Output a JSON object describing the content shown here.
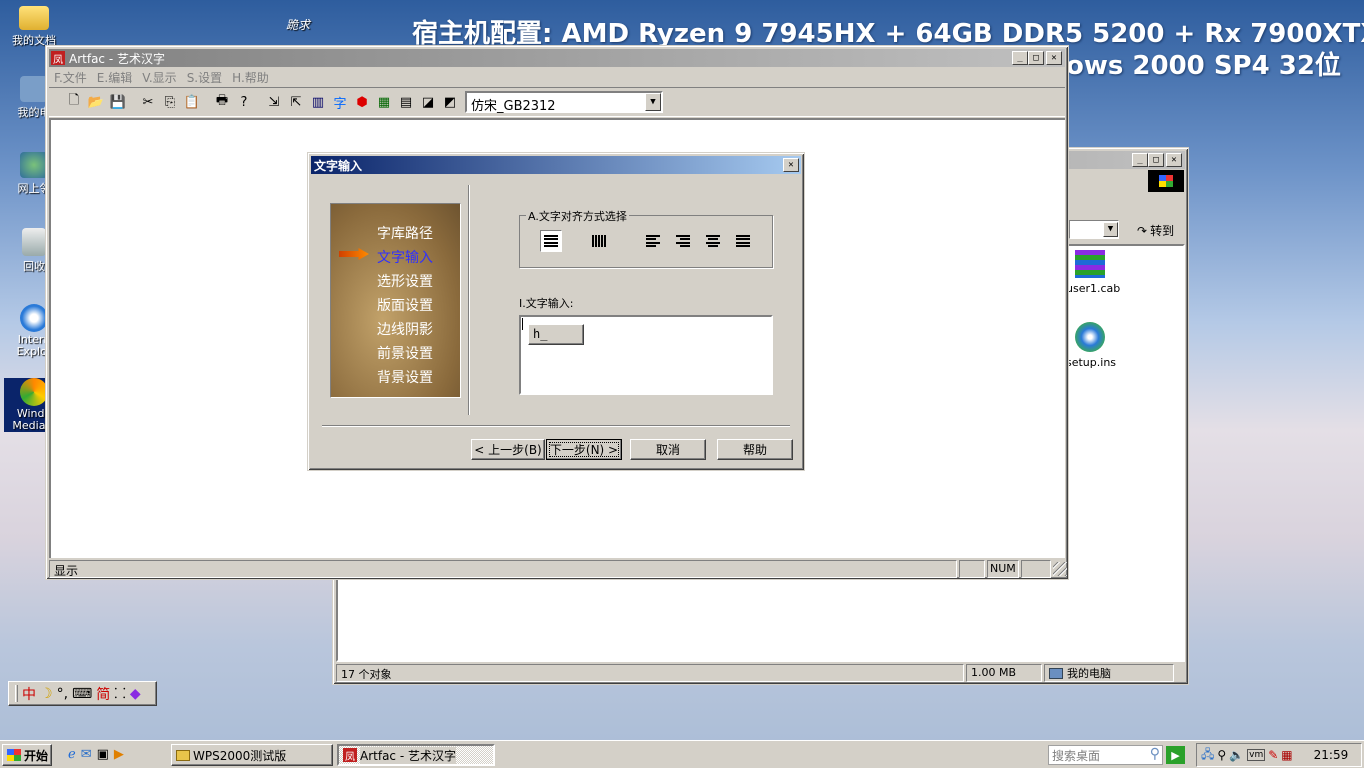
{
  "banner": {
    "line1": "宿主机配置: AMD Ryzen 9 7945HX + 64GB DDR5 5200 + Rx 7900XTX",
    "line2": "ows 2000 SP4 32位"
  },
  "desktop_icons": [
    "我的文档",
    "我的电",
    "网上邻",
    "回收",
    "Intern Explor",
    "Windo Media P"
  ],
  "main_window": {
    "title": "Artfac - 艺术汉字",
    "menu": [
      "F.文件",
      "E.编辑",
      "V.显示",
      "S.设置",
      "H.帮助"
    ],
    "font_select": "仿宋_GB2312",
    "status_left": "显示",
    "status_num": "NUM"
  },
  "dialog": {
    "title": "文字输入",
    "steps": [
      "字库路径",
      "文字输入",
      "选形设置",
      "版面设置",
      "边线阴影",
      "前景设置",
      "背景设置"
    ],
    "align_group_label": "A.文字对齐方式选择",
    "text_input_label": "I.文字输入:",
    "ime_composition": "h_",
    "btn_prev": "< 上一步(B)",
    "btn_next": "下一步(N) >",
    "btn_cancel": "取消",
    "btn_help": "帮助"
  },
  "explorer": {
    "goto": "转到",
    "files": [
      "user1.cab",
      "setup.ins"
    ],
    "status_count": "17 个对象",
    "status_size": "1.00 MB",
    "status_location": "我的电脑"
  },
  "ime_bar": {
    "mode": "中",
    "simplified": "简"
  },
  "taskbar": {
    "start": "开始",
    "items": [
      "WPS2000测试版",
      "Artfac - 艺术汉字"
    ],
    "search_placeholder": "搜索桌面",
    "clock": "21:59"
  },
  "colors": {
    "title_active": "#0a246a",
    "title_gradient": "#a6caf0",
    "title_inactive": "#808080",
    "face": "#d4d0c8"
  }
}
